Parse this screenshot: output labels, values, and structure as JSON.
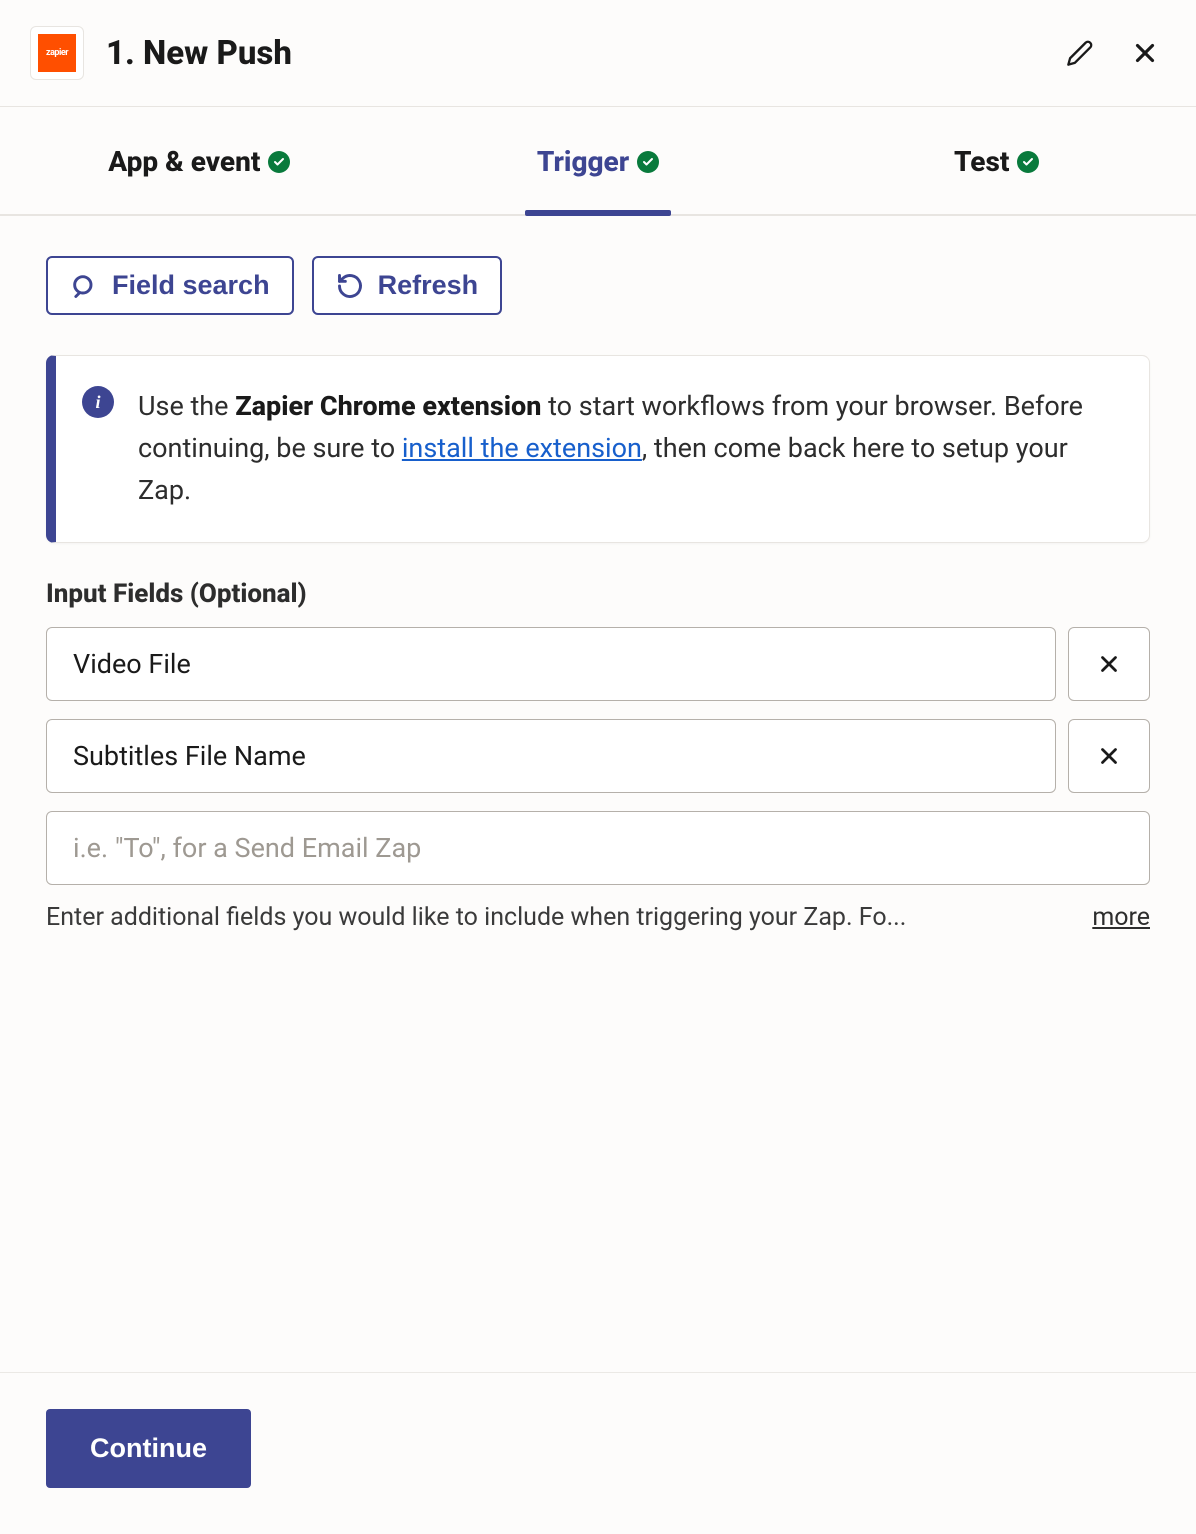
{
  "header": {
    "logo_text": "zapier",
    "title": "1. New Push"
  },
  "tabs": [
    {
      "label": "App & event",
      "active": false,
      "checked": true
    },
    {
      "label": "Trigger",
      "active": true,
      "checked": true
    },
    {
      "label": "Test",
      "active": false,
      "checked": true
    }
  ],
  "actions": {
    "field_search": "Field search",
    "refresh": "Refresh"
  },
  "info": {
    "pre": "Use the ",
    "bold": "Zapier Chrome extension",
    "mid": " to start workflows from your browser. Before continuing, be sure to ",
    "link": "install the extension",
    "post": ", then come back here to setup your Zap."
  },
  "fields": {
    "section_label": "Input Fields (Optional)",
    "items": [
      {
        "value": "Video File"
      },
      {
        "value": "Subtitles File Name"
      }
    ],
    "placeholder": "i.e. \"To\", for a Send Email Zap",
    "helper": "Enter additional fields you would like to include when triggering your Zap. Fo...",
    "more": "more"
  },
  "footer": {
    "continue": "Continue"
  }
}
